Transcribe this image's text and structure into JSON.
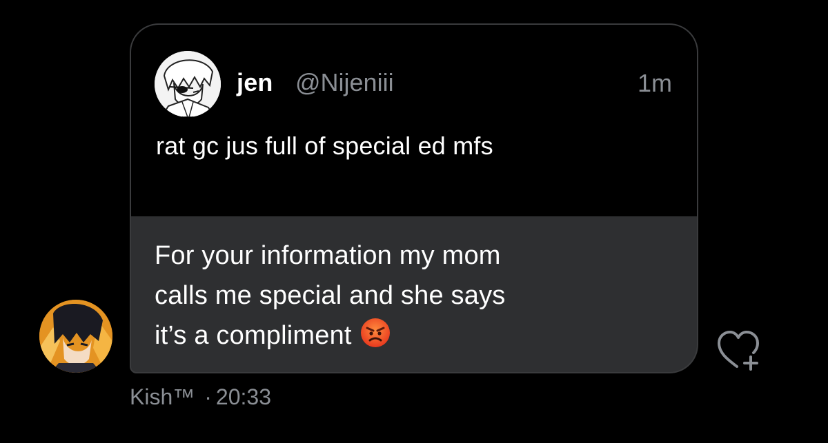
{
  "quoted_tweet": {
    "author_name": "jen",
    "author_handle": "@Nijeniii",
    "time_ago": "1m",
    "text": "rat gc jus full of special ed mfs"
  },
  "reply": {
    "lines": [
      "For your information my mom",
      "calls me special and she says",
      "it’s a compliment"
    ],
    "emoji": "angry-face"
  },
  "meta": {
    "sender": "Kish™",
    "timestamp": "20:33",
    "separator": "·"
  },
  "icons": {
    "reaction": "heart-plus-icon",
    "quoted_avatar": "avatar",
    "sender_avatar": "avatar"
  },
  "colors": {
    "background": "#000000",
    "bubble": "#2e2f31",
    "muted_text": "#8b8f95"
  }
}
